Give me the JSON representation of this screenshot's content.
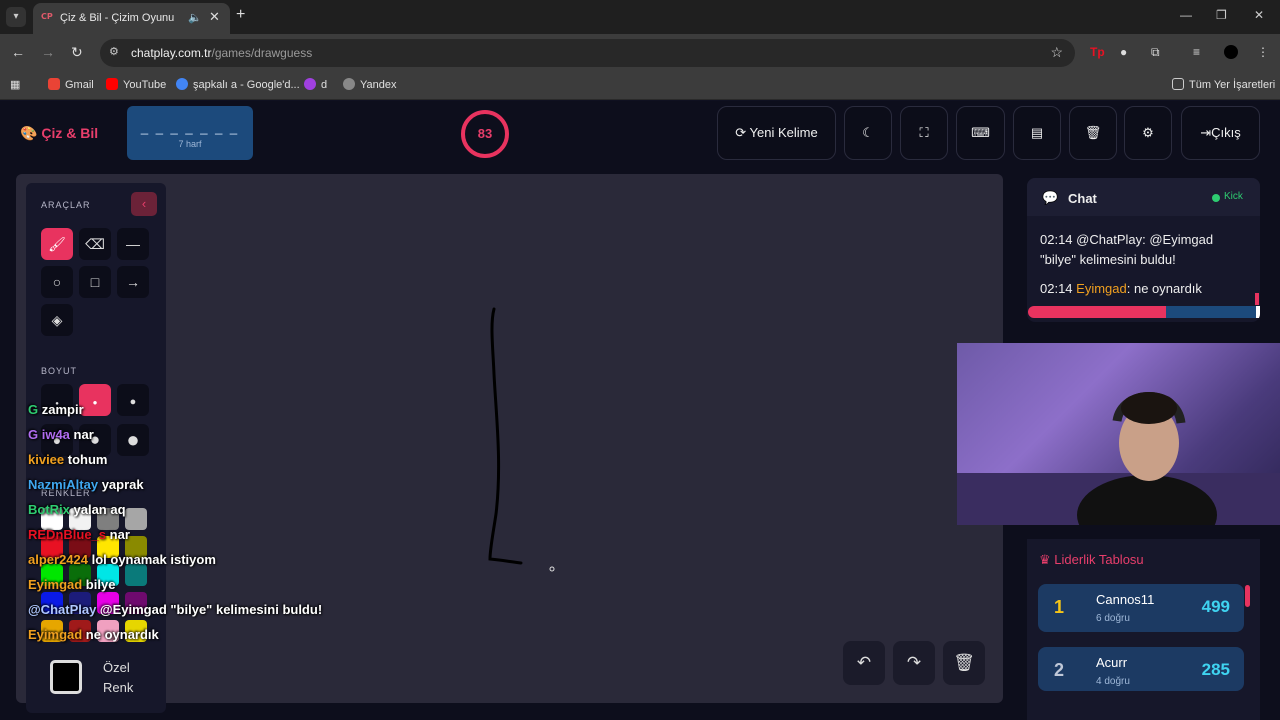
{
  "browser": {
    "tab_title": "Çiz & Bil - Çizim Oyunu",
    "tab_favicon": "CP",
    "url_host": "chatplay.com.tr",
    "url_path": "/games/drawguess",
    "bookmarks": [
      "Gmail",
      "YouTube",
      "şapkalı a - Google'd...",
      "d",
      "Yandex"
    ],
    "all_bookmarks": "Tüm Yer İşaretleri"
  },
  "app": {
    "brand": "Çiz & Bil",
    "word_hint": "_ _ _ _ _ _ _",
    "word_letters": "7 harf",
    "timer": "83",
    "new_word": "Yeni Kelime",
    "exit": "Çıkış"
  },
  "tools": {
    "section_tools": "ARAÇLAR",
    "section_size": "BOYUT",
    "section_colors": "RENKLER",
    "custom_color_line1": "Özel",
    "custom_color_line2": "Renk",
    "colors": [
      "#ffffff",
      "#f2f2f2",
      "#7f7f7f",
      "#a6a6a6",
      "#e81123",
      "#7a0d16",
      "#ffe600",
      "#8a8a00",
      "#00e600",
      "#0a6e0a",
      "#00e6e6",
      "#0a7a7a",
      "#0a1ae6",
      "#1c1c7a",
      "#e600e6",
      "#6e0a6e",
      "#e6a600",
      "#a01a1a",
      "#f0a0c0",
      "#e6d600"
    ]
  },
  "chat": {
    "title": "Chat",
    "kick_label": "Kick",
    "messages": [
      {
        "time": "02:14",
        "user": "@ChatPlay",
        "text": ": @Eyimgad \"bilye\" kelimesini buldu!"
      },
      {
        "time": "02:14",
        "user": "Eyimgad",
        "text": ": ne oynardık"
      }
    ]
  },
  "leaderboard": {
    "title": "Liderlik Tablosu",
    "rows": [
      {
        "rank": "1",
        "name": "Cannos11",
        "sub": "6 doğru",
        "score": "499"
      },
      {
        "rank": "2",
        "name": "Acurr",
        "sub": "4 doğru",
        "score": "285"
      }
    ]
  },
  "overlay_chat": [
    {
      "user": "G",
      "text": "zampir",
      "color": "#2ecc71"
    },
    {
      "user": "G iw4a",
      "text": "nar",
      "color": "#b06cf0"
    },
    {
      "user": "kiviee",
      "text": "tohum",
      "color": "#f0a020"
    },
    {
      "user": "NazmiAltay",
      "text": "yaprak",
      "color": "#3fa8f0"
    },
    {
      "user": "BotRix",
      "text": "yalan aq",
      "color": "#2ecc71"
    },
    {
      "user": "REDnBlue_s",
      "text": "nar",
      "color": "#e81123"
    },
    {
      "user": "alper2424",
      "text": "lol oynamak istiyom",
      "color": "#f0a020"
    },
    {
      "user": "Eyimgad",
      "text": "bilye",
      "color": "#f0a020"
    },
    {
      "user": "@ChatPlay",
      "text": "@Eyimgad \"bilye\" kelimesini buldu!",
      "color": "#b0c8ff"
    },
    {
      "user": "Eyimgad",
      "text": "ne oynardık",
      "color": "#f0a020"
    }
  ]
}
